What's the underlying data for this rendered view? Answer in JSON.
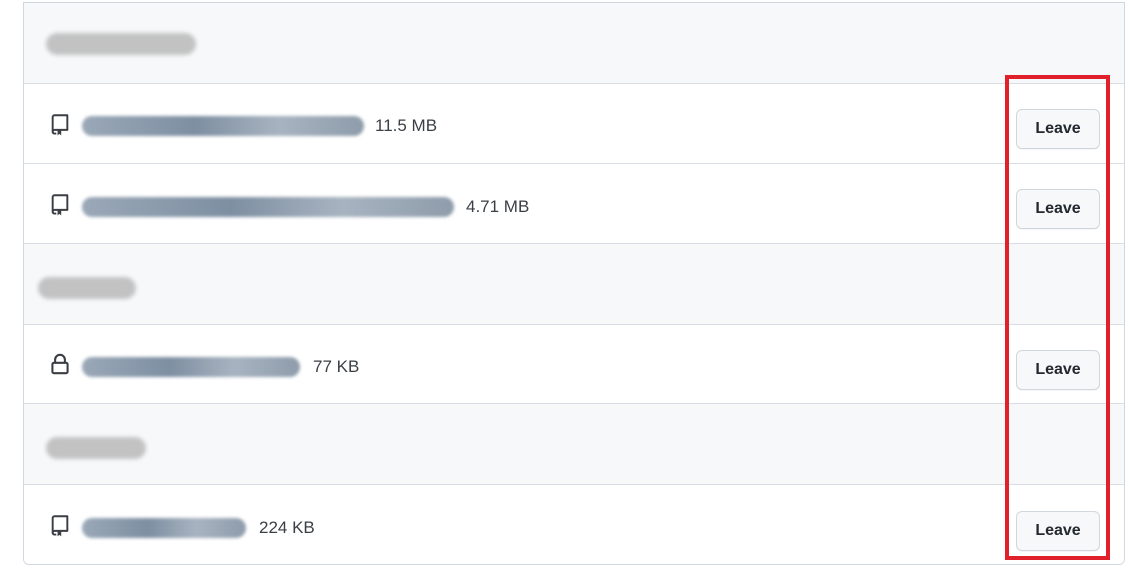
{
  "groups": [
    {
      "owner": "",
      "repos": [
        {
          "icon": "repo-icon",
          "name": "",
          "size": "11.5 MB",
          "action": "Leave"
        },
        {
          "icon": "repo-icon",
          "name": "",
          "size": "4.71 MB",
          "action": "Leave"
        }
      ]
    },
    {
      "owner": "",
      "repos": [
        {
          "icon": "lock-icon",
          "name": "",
          "size": "77 KB",
          "action": "Leave"
        }
      ]
    },
    {
      "owner": "",
      "repos": [
        {
          "icon": "repo-icon",
          "name": "",
          "size": "224 KB",
          "action": "Leave"
        }
      ]
    }
  ],
  "highlight_color": "#e0212b",
  "link_color": "#0969da"
}
